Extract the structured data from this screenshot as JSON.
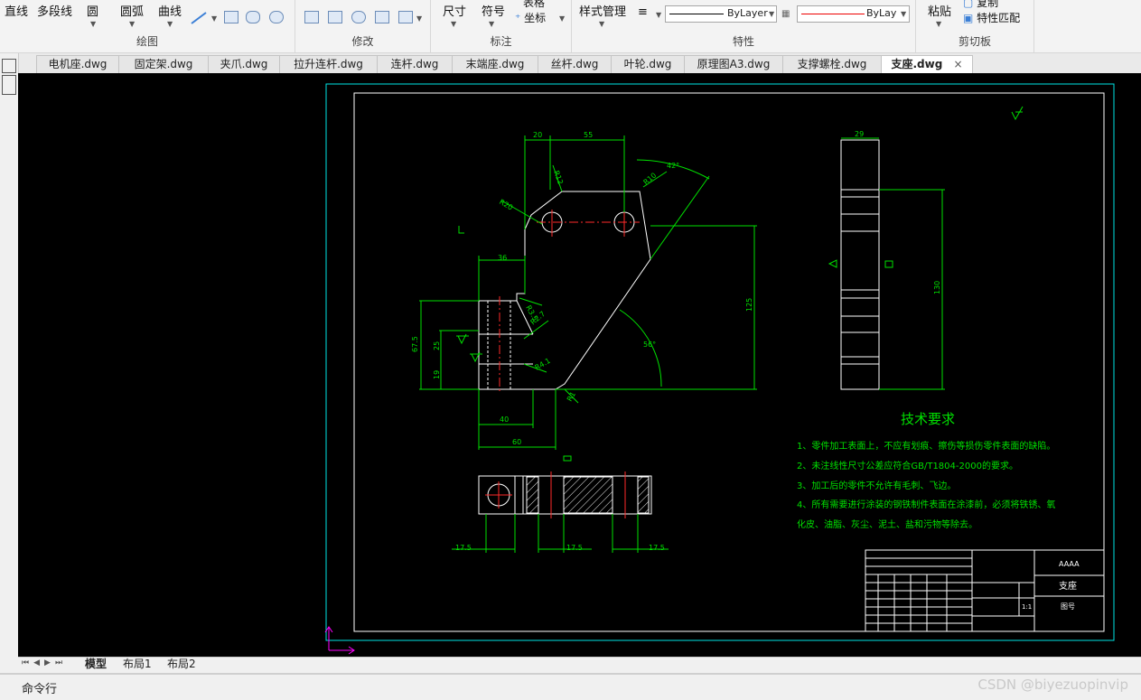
{
  "ribbon": {
    "draw": {
      "title": "绘图",
      "line": "直线",
      "polyline": "多段线",
      "circle": "圆",
      "arc": "圆弧",
      "curve": "曲线"
    },
    "modify": {
      "title": "修改"
    },
    "annotate": {
      "title": "标注",
      "dimension": "尺寸",
      "symbol": "符号",
      "table": "表格",
      "coordinate": "坐标"
    },
    "properties": {
      "title": "特性",
      "style_manager": "样式管理",
      "linetype": "ByLayer",
      "color": "ByLayer"
    },
    "clipboard": {
      "title": "剪切板",
      "paste": "粘贴",
      "copy": "复制",
      "match": "特性匹配"
    }
  },
  "tabs": [
    "电机座.dwg",
    "固定架.dwg",
    "夹爪.dwg",
    "拉升连杆.dwg",
    "连杆.dwg",
    "末端座.dwg",
    "丝杆.dwg",
    "叶轮.dwg",
    "原理图A3.dwg",
    "支撑螺栓.dwg",
    "支座.dwg"
  ],
  "active_tab": "支座.dwg",
  "close_glyph": "×",
  "drawing": {
    "dims": {
      "d20": "20",
      "d55": "55",
      "r12": "R12",
      "r10": "R10",
      "r20": "R20",
      "a42": "42°",
      "d36": "36",
      "r35": "R3.5",
      "r27": "R2.7",
      "r41": "R4.1",
      "d675": "67.5",
      "d25": "25",
      "d19": "19",
      "d40": "40",
      "d60": "60",
      "a56": "56°",
      "d125": "125",
      "r1": "R1",
      "d29": "29",
      "d130": "130",
      "s175a": "17.5",
      "s175b": "17.5",
      "s175c": "17.5"
    },
    "tech_title": "技术要求",
    "tech_notes": [
      "1、零件加工表面上，不应有划痕、擦伤等损伤零件表面的缺陷。",
      "2、未注线性尺寸公差应符合GB/T1804-2000的要求。",
      "3、加工后的零件不允许有毛刺、飞边。",
      "4、所有需要进行涂装的钢铁制件表面在涂漆前，必须将铁锈、氧",
      "化皮、油脂、灰尘、泥土、盐和污物等除去。"
    ],
    "title_block": {
      "part_name": "支座",
      "drawing_no": "图号",
      "scale": "1:1",
      "company": "AAAA"
    }
  },
  "layout_tabs": [
    "模型",
    "布局1",
    "布局2"
  ],
  "command_label": "命令行",
  "watermark": "CSDN @biyezuopinvip"
}
